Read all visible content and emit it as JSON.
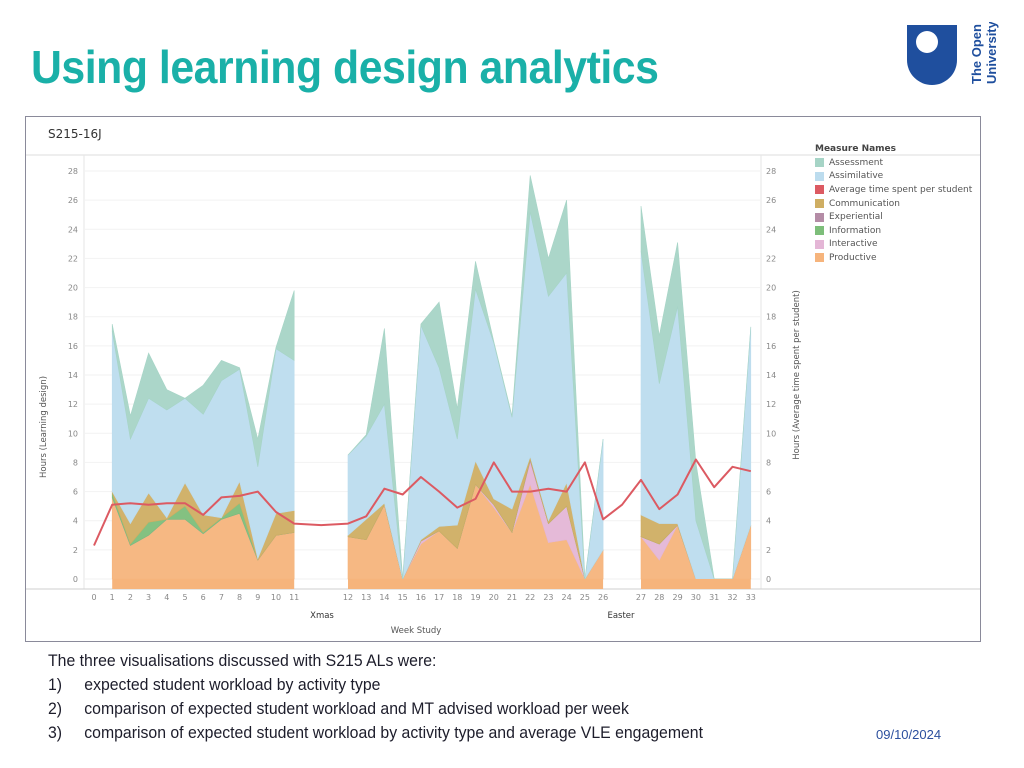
{
  "slide": {
    "title": "Using learning design analytics",
    "logo_text_line1": "The Open",
    "logo_text_line2": "University",
    "logo_color": "#1f4f9e",
    "title_color": "#1ab0a8",
    "date": "09/10/2024",
    "intro": "The three visualisations discussed with S215 ALs were:",
    "points": [
      {
        "num": "1)",
        "text": "expected student workload by activity type"
      },
      {
        "num": "2)",
        "text": "comparison of expected student workload and MT advised workload per week"
      },
      {
        "num": "3)",
        "text": "comparison of expected student workload by activity type and average VLE engagement"
      }
    ]
  },
  "chart_data": {
    "type": "area",
    "title": "S215-16J",
    "xlabel": "Week Study",
    "ylabel": "Hours (Learning design)",
    "y2label": "Hours (Average time spent per student)",
    "ylim": [
      0,
      28
    ],
    "yticks": [
      0,
      2,
      4,
      6,
      8,
      10,
      12,
      14,
      16,
      18,
      20,
      22,
      24,
      26,
      28
    ],
    "grid": true,
    "legend_title": "Measure Names",
    "legend_position": "right",
    "break_labels": [
      {
        "label": "Xmas",
        "after_week": 11
      },
      {
        "label": "Easter",
        "after_week": 26
      }
    ],
    "legend": [
      {
        "name": "Assessment",
        "color": "#a6d4c6"
      },
      {
        "name": "Assimilative",
        "color": "#bcdcee"
      },
      {
        "name": "Average time spent per student",
        "color": "#dc5a62"
      },
      {
        "name": "Communication",
        "color": "#cfae63"
      },
      {
        "name": "Experiential",
        "color": "#b48ca6"
      },
      {
        "name": "Information",
        "color": "#7dbe7a"
      },
      {
        "name": "Interactive",
        "color": "#e4b6d6"
      },
      {
        "name": "Productive",
        "color": "#f6b47c"
      }
    ],
    "weeks": [
      1,
      2,
      3,
      4,
      5,
      6,
      7,
      8,
      9,
      10,
      11,
      12,
      13,
      14,
      15,
      16,
      17,
      18,
      19,
      20,
      21,
      22,
      23,
      24,
      25,
      26,
      27,
      28,
      29,
      30,
      31,
      32,
      33
    ],
    "x_tick_labels": [
      "0",
      "1",
      "2",
      "3",
      "4",
      "5",
      "6",
      "7",
      "8",
      "9",
      "10",
      "11",
      "12",
      "13",
      "14",
      "15",
      "16",
      "17",
      "18",
      "19",
      "20",
      "21",
      "22",
      "23",
      "24",
      "25",
      "26",
      "27",
      "28",
      "29",
      "30",
      "31",
      "32",
      "33"
    ],
    "segments": [
      [
        1,
        11
      ],
      [
        12,
        26
      ],
      [
        27,
        33
      ]
    ],
    "stacked_series": [
      {
        "name": "Productive",
        "values": [
          5.6,
          2.3,
          3.0,
          4.1,
          4.1,
          3.1,
          4.1,
          4.5,
          1.3,
          3.0,
          3.2,
          2.9,
          2.7,
          5.1,
          0,
          2.4,
          3.3,
          2.1,
          6.5,
          4.9,
          3.2,
          6.5,
          2.5,
          2.7,
          0,
          2.0,
          2.9,
          1.3,
          3.7,
          0,
          0,
          0,
          3.7
        ]
      },
      {
        "name": "Interactive",
        "values": [
          0,
          0,
          0,
          0,
          0,
          0,
          0,
          0,
          0,
          0,
          0,
          0,
          0,
          0,
          0,
          0.2,
          0,
          0,
          0,
          0.2,
          0,
          1.6,
          1.3,
          2.3,
          0,
          0,
          0,
          1.1,
          0,
          0,
          0,
          0,
          0
        ]
      },
      {
        "name": "Experiential",
        "values": [
          0,
          0,
          0,
          0,
          0,
          0,
          0,
          0,
          0,
          0,
          0,
          0,
          0,
          0,
          0,
          0,
          0,
          0,
          0,
          0,
          0,
          0.1,
          0,
          0,
          0,
          0,
          0,
          0,
          0,
          0,
          0,
          0,
          0
        ]
      },
      {
        "name": "Information",
        "values": [
          0.3,
          0.1,
          0.9,
          0,
          0.9,
          0.1,
          0.1,
          0.7,
          0,
          0,
          0,
          0,
          0,
          0,
          0,
          0,
          0,
          0,
          0,
          0,
          0,
          0,
          0,
          0,
          0,
          0,
          0,
          0,
          0,
          0,
          0,
          0,
          0
        ]
      },
      {
        "name": "Communication",
        "values": [
          0.1,
          1.4,
          2.0,
          0.1,
          1.6,
          1.2,
          0,
          1.5,
          0.1,
          1.5,
          1.5,
          0.1,
          1.4,
          0.1,
          0,
          0.1,
          0.3,
          1.6,
          1.6,
          0.4,
          1.6,
          0.2,
          0.2,
          1.6,
          0,
          0,
          1.5,
          1.4,
          0.1,
          0,
          0,
          0,
          0
        ]
      },
      {
        "name": "Assimilative",
        "values": [
          11.0,
          5.8,
          6.5,
          7.4,
          5.8,
          6.9,
          9.4,
          7.7,
          6.3,
          11.3,
          10.3,
          5.5,
          5.7,
          6.8,
          0,
          14.7,
          10.9,
          5.9,
          11.8,
          10.7,
          6.3,
          16.8,
          15.4,
          14.4,
          0,
          7.6,
          18.1,
          9.6,
          14.9,
          4.0,
          0,
          0,
          13.6
        ]
      },
      {
        "name": "Assessment",
        "values": [
          0.5,
          1.6,
          3.1,
          1.4,
          0,
          2.0,
          1.4,
          0.1,
          1.9,
          0.1,
          4.8,
          0,
          0.1,
          5.2,
          0,
          0.1,
          4.5,
          2.1,
          1.9,
          0.1,
          0.1,
          2.5,
          2.6,
          5.0,
          0,
          0,
          3.1,
          3.3,
          4.4,
          4.0,
          0,
          0,
          0
        ]
      }
    ],
    "line_series": {
      "name": "Average time spent per student",
      "x": [
        0,
        1,
        2,
        3,
        4,
        5,
        6,
        7,
        8,
        9,
        10,
        11,
        11.5,
        12,
        13,
        14,
        15,
        16,
        17,
        18,
        19,
        20,
        21,
        22,
        23,
        24,
        25,
        26,
        26.5,
        27,
        28,
        29,
        30,
        31,
        32,
        33
      ],
      "values": [
        2.3,
        5.1,
        5.2,
        5.1,
        5.2,
        5.2,
        4.4,
        5.6,
        5.7,
        6.0,
        4.6,
        3.8,
        3.7,
        3.8,
        4.3,
        6.2,
        5.8,
        7.0,
        6.0,
        4.9,
        5.5,
        8.0,
        6.0,
        6.0,
        6.2,
        6.0,
        8.0,
        4.1,
        5.1,
        6.8,
        4.8,
        5.8,
        8.2,
        6.3,
        7.7,
        7.4
      ]
    }
  }
}
